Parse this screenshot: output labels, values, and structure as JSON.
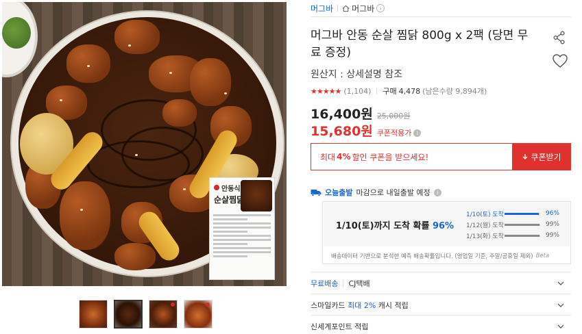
{
  "breadcrumb": {
    "seller": "머그바",
    "store": "머그바"
  },
  "product": {
    "title": "머그바 안동 순살 찜닭 800g x 2팩 (당면 무료 증정)",
    "origin": "원산지 : 상세설명 참조",
    "rating_stars": 4.5,
    "review_count": "(1,104)",
    "purchase_label": "구매",
    "purchase_count": "4,478",
    "remaining": "(남은수량 9,894개)",
    "price": "16,400원",
    "original_price": "25,000원",
    "coupon_price": "15,680원",
    "coupon_price_label": "쿠폰적용가",
    "package_brand": "안동식",
    "package_title": "순살찜닭"
  },
  "coupon": {
    "text_prefix": "최대",
    "text_pct": "4%",
    "text_suffix": "할인 쿠폰을 받으세요!",
    "button_label": "쿠폰받기"
  },
  "delivery": {
    "today_label": "오늘출발",
    "today_text": "마감으로 내일출발 예정",
    "prediction_prefix": "1/10(토)까지 도착 확률",
    "prediction_pct": "96%",
    "rows": [
      {
        "label": "1/10(토) 도착",
        "pct": "96%",
        "value": 0.96
      },
      {
        "label": "1/12(월) 도착",
        "pct": "99%",
        "value": 0.99
      },
      {
        "label": "1/13(화) 도착",
        "pct": "99%",
        "value": 0.99
      }
    ],
    "note": "배송데이터 기반으로 분석한 예측 배송확률입니다. (영업일 기준, 주말/공휴일 제외)",
    "beta": "Beta"
  },
  "accordions": {
    "shipping_label": "무료배송",
    "shipping_carrier": "CJ택배",
    "smile_prefix": "스마일카드",
    "smile_highlight": "최대 2%",
    "smile_suffix": "캐시 적립",
    "shinsegae": "신세계포인트 적립"
  },
  "colors": {
    "accent_red": "#e0322d",
    "accent_blue": "#1b66d6"
  }
}
